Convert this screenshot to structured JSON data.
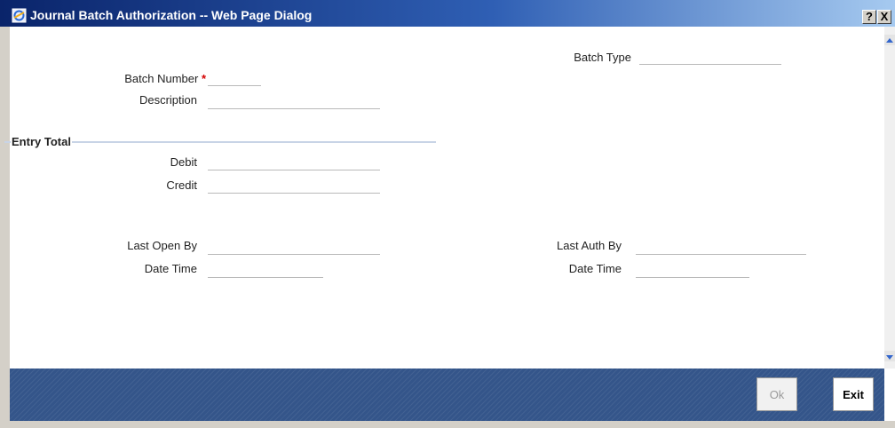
{
  "window": {
    "title": "Journal Batch Authorization -- Web Page Dialog",
    "help_label": "?",
    "close_label": "X"
  },
  "form": {
    "batch_number_label": "Batch Number",
    "required_marker": "*",
    "description_label": "Description",
    "batch_type_label": "Batch Type",
    "batch_number_value": "",
    "description_value": "",
    "batch_type_value": ""
  },
  "entry_total": {
    "section_title": "Entry Total",
    "debit_label": "Debit",
    "credit_label": "Credit",
    "debit_value": "",
    "credit_value": ""
  },
  "audit": {
    "last_open_by_label": "Last Open By",
    "last_open_date_time_label": "Date Time",
    "last_auth_by_label": "Last Auth By",
    "last_auth_date_time_label": "Date Time",
    "last_open_by_value": "",
    "last_open_date_time_value": "",
    "last_auth_by_value": "",
    "last_auth_date_time_value": ""
  },
  "buttons": {
    "ok_label": "Ok",
    "exit_label": "Exit"
  },
  "colors": {
    "title_bar": "#0a246a",
    "footer": "#34558a",
    "required": "#d40000"
  },
  "icons": {
    "window_icon": "ie-page-icon",
    "scroll_up": "scroll-up-arrow-icon",
    "scroll_down": "scroll-down-arrow-icon"
  }
}
